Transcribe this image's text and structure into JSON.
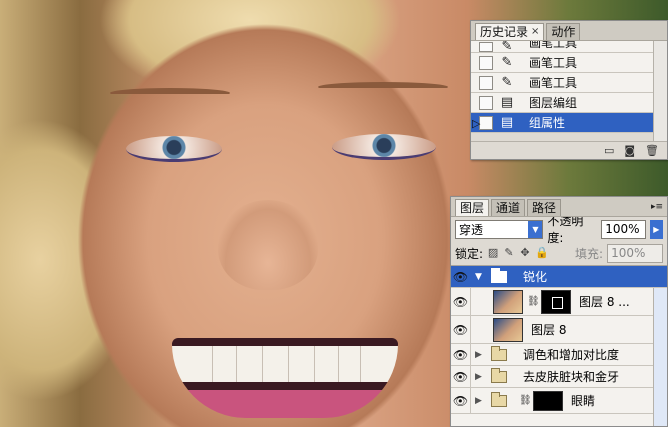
{
  "history_panel": {
    "tabs": [
      {
        "label": "历史记录",
        "active": true,
        "close": "×"
      },
      {
        "label": "动作",
        "active": false
      }
    ],
    "items": [
      {
        "label": "画笔工具",
        "icon": "brush-icon",
        "selected": false
      },
      {
        "label": "画笔工具",
        "icon": "brush-icon",
        "selected": false
      },
      {
        "label": "画笔工具",
        "icon": "brush-icon",
        "selected": false
      },
      {
        "label": "图层编组",
        "icon": "history-state-icon",
        "selected": false
      },
      {
        "label": "组属性",
        "icon": "history-state-icon",
        "selected": true
      }
    ],
    "footer_icons": [
      "new-document-icon",
      "snapshot-icon",
      "trash-icon"
    ]
  },
  "layers_panel": {
    "tabs": [
      {
        "label": "图层",
        "active": true
      },
      {
        "label": "通道",
        "active": false
      },
      {
        "label": "路径",
        "active": false
      }
    ],
    "blend_mode": "穿透",
    "opacity_label": "不透明度:",
    "opacity_value": "100%",
    "lock_label": "锁定:",
    "fill_label": "填充:",
    "fill_value": "100%",
    "layers": [
      {
        "name": "锐化",
        "kind": "group",
        "expanded": true,
        "selected": true,
        "visible": true
      },
      {
        "name": "图层 8 ...",
        "kind": "layer-with-mask",
        "selected": false,
        "visible": true
      },
      {
        "name": "图层 8",
        "kind": "layer",
        "selected": false,
        "visible": true
      },
      {
        "name": "调色和增加对比度",
        "kind": "group",
        "expanded": false,
        "selected": false,
        "visible": true
      },
      {
        "name": "去皮肤脏块和金牙",
        "kind": "group",
        "expanded": false,
        "selected": false,
        "visible": true
      },
      {
        "name": "眼睛",
        "kind": "group-with-mask",
        "expanded": false,
        "selected": false,
        "visible": true
      }
    ]
  },
  "colors": {
    "selection": "#2f61c1",
    "panel_bg": "#dedad3",
    "row_bg": "#f4f2ee",
    "dropdown_arrow": "#3a6fd0"
  }
}
